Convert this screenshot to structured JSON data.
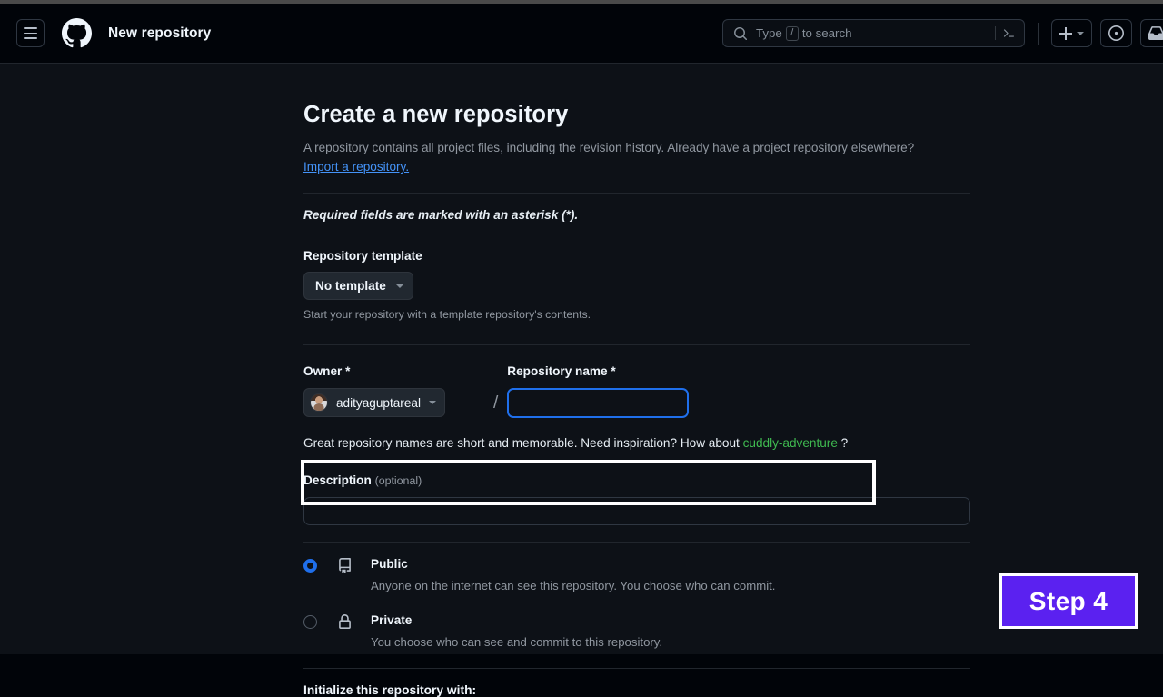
{
  "header": {
    "menu_icon": "hamburger-icon",
    "logo_icon": "github-logo-icon",
    "title": "New repository",
    "search": {
      "icon": "search-icon",
      "placeholder_before": "Type",
      "placeholder_key": "/",
      "placeholder_after": "to search",
      "terminal_icon": "terminal-icon"
    },
    "create_button": {
      "icon": "plus-icon",
      "chevron": "chevron-down-icon"
    },
    "issues_button": {
      "icon": "issue-opened-icon"
    },
    "inbox_button": {
      "icon": "inbox-icon"
    }
  },
  "form": {
    "heading": "Create a new repository",
    "description_line": "A repository contains all project files, including the revision history. Already have a project repository elsewhere?",
    "import_link": "Import a repository.",
    "required_note": "Required fields are marked with an asterisk (*).",
    "template": {
      "label": "Repository template",
      "selected": "No template",
      "chevron": "chevron-down-icon",
      "help": "Start your repository with a template repository's contents."
    },
    "owner": {
      "label": "Owner *",
      "name": "adityaguptareal",
      "avatar": "user-avatar",
      "chevron": "chevron-down-icon",
      "separator": "/"
    },
    "repo_name": {
      "label": "Repository name *",
      "value": "",
      "placeholder": "",
      "focused": true
    },
    "name_hint_prefix": "Great repository names are short and memorable. Need inspiration? How about",
    "name_suggestion": "cuddly-adventure",
    "name_hint_suffix": "?",
    "description": {
      "label": "Description",
      "optional": "(optional)",
      "value": "",
      "placeholder": ""
    },
    "visibility": [
      {
        "id": "public",
        "title": "Public",
        "desc": "Anyone on the internet can see this repository. You choose who can commit.",
        "icon": "repo-book-icon",
        "selected": true
      },
      {
        "id": "private",
        "title": "Private",
        "desc": "You choose who can see and commit to this repository.",
        "icon": "lock-icon",
        "selected": false
      }
    ],
    "initialize_title": "Initialize this repository with:"
  },
  "annotations": {
    "step_badge_label": "Step 4",
    "step_badge_color": "#5b21f0",
    "highlight_border_color": "#ffffff"
  },
  "colors": {
    "page_background": "#0d1117",
    "header_background": "#010409",
    "accent_blue": "#1f6feb",
    "link_blue": "#4493f8",
    "suggestion_green": "#3fb950",
    "muted_text": "#9198a1",
    "primary_text": "#f0f6fc",
    "border": "#21262d"
  }
}
